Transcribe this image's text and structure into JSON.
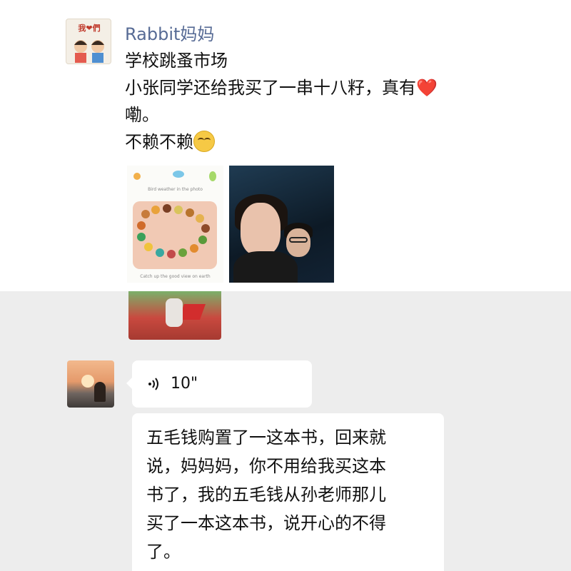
{
  "post": {
    "username": "Rabbit妈妈",
    "avatar_caption": "我❤們",
    "lines": [
      "学校跳蚤市场",
      "小张同学还给我买了一串十八籽，真有",
      "嘞。",
      "不赖不赖"
    ],
    "heart_glyph": "❤️",
    "photo1": {
      "caption_top": "Bird weather in the photo",
      "caption_bottom": "Catch up the good view on earth"
    }
  },
  "chat": {
    "voice_duration": "10\"",
    "message_lines": [
      "五毛钱购置了一这本书，回来就",
      "说，妈妈妈，你不用给我买这本",
      "书了，我的五毛钱从孙老师那儿",
      "买了一本这本书，说开心的不得",
      "了。"
    ]
  },
  "icons": {
    "voice": "voice-wave-icon",
    "emoji": "smirk-emoji-icon",
    "heart": "heart-icon"
  },
  "colors": {
    "username": "#576b95",
    "chat_background": "#ededed",
    "bubble": "#ffffff"
  }
}
